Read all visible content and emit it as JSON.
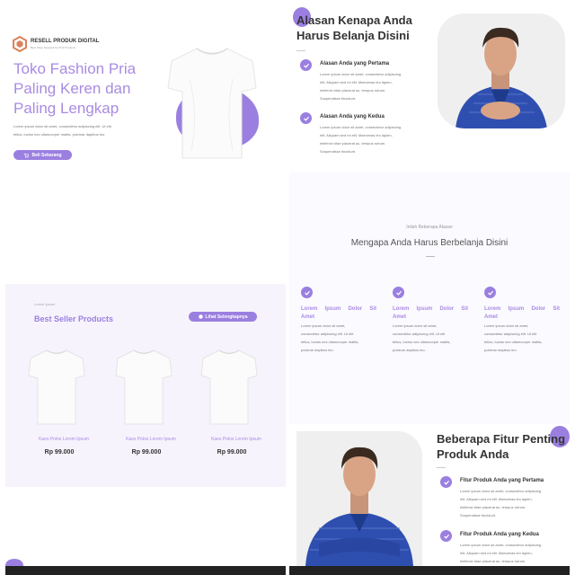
{
  "hero": {
    "brand": "RESELL PRODUK DIGITAL",
    "brand_tagline": "Best Shop Selected for PLR Products",
    "title_line1": "Toko Fashion Pria",
    "title_line2": "Paling Keren dan",
    "title_line3": "Paling Lengkap",
    "desc_line1": "Lorem ipsum dolor sit amet, consectetur adipiscing elit. Ut elit",
    "desc_line2": "tellus, luctus nec ullamcorper mattis, pulvinar dapibus leo.",
    "cta_label": "Beli Sekarang"
  },
  "bestseller": {
    "eyebrow": "Lorem Ipsum",
    "title": "Best Seller Products",
    "button_label": "Lihat Selengkapnya",
    "products": [
      {
        "name": "Kaos Polos Lorem Ipsum",
        "price": "Rp 99.000"
      },
      {
        "name": "Kaos Polos Lorem Ipsum",
        "price": "Rp 99.000"
      },
      {
        "name": "Kaos Polos Lorem Ipsum",
        "price": "Rp 99.000"
      }
    ]
  },
  "reasons": {
    "title_line1": "Alasan Kenapa Anda",
    "title_line2": "Harus Belanja Disini",
    "items": [
      {
        "title": "Alasan Anda yang Pertama",
        "text": [
          "Lorem ipsum dolor sit amet, consectetur adipiscing",
          "elit. Aliquam sed mi elit. Maecenas leo lapien,",
          "eleifend vitae placerat ac, tempus rutrum.",
          "Suspendisse tincidunt."
        ]
      },
      {
        "title": "Alasan Anda yang Kedua",
        "text": [
          "Lorem ipsum dolor sit amet, consectetur adipiscing",
          "elit. Aliquam sed mi elit. Maecenas leo lapien,",
          "eleifend vitae placerat ac, tempus rutrum.",
          "Suspendisse tincidunt."
        ]
      }
    ]
  },
  "why": {
    "eyebrow": "Inilah Beberapa Alasan",
    "title": "Mengapa Anda Harus Berbelanja Disini",
    "columns": [
      {
        "title_line1": "Lorem Ipsum Dolor Sit",
        "title_line2": "Amet",
        "text": [
          "Lorem ipsum dolor sit amet,",
          "consectetur adipiscing elit. Ut elit",
          "tellus, luctus nec ullamcorper mattis,",
          "pulvinar dapibus leo."
        ]
      },
      {
        "title_line1": "Lorem Ipsum Dolor Sit",
        "title_line2": "Amet",
        "text": [
          "Lorem ipsum dolor sit amet,",
          "consectetur adipiscing elit. Ut elit",
          "tellus, luctus nec ullamcorper mattis,",
          "pulvinar dapibus leo."
        ]
      },
      {
        "title_line1": "Lorem Ipsum Dolor Sit",
        "title_line2": "Amet",
        "text": [
          "Lorem ipsum dolor sit amet,",
          "consectetur adipiscing elit. Ut elit",
          "tellus, luctus nec ullamcorper mattis,",
          "pulvinar dapibus leo."
        ]
      }
    ]
  },
  "features": {
    "title_line1": "Beberapa Fitur Penting",
    "title_line2": "Produk Anda",
    "items": [
      {
        "title": "Fitur Produk Anda yang Pertama",
        "text": [
          "Lorem ipsum dolor sit amet, consectetur adipiscing",
          "elit. Aliquam sed mi elit. Maecenas leo lapien,",
          "eleifend vitae placerat ac, tempus rutrum.",
          "Suspendisse tincidunt."
        ]
      },
      {
        "title": "Fitur Produk Anda yang Kedua",
        "text": [
          "Lorem ipsum dolor sit amet, consectetur adipiscing",
          "elit. Aliquam sed mi elit. Maecenas leo lapien,",
          "eleifend vitae placerat ac, tempus rutrum."
        ]
      }
    ]
  },
  "colors": {
    "accent": "#9b7fe0",
    "shirt_blue": "#2f4fb0"
  }
}
